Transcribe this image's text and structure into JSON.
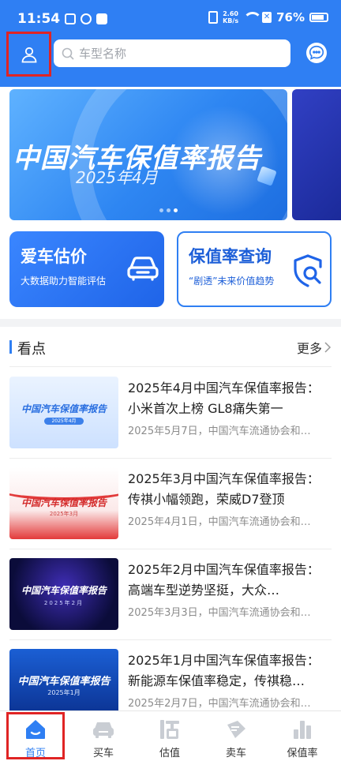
{
  "status_bar": {
    "time": "11:54",
    "net_speed_value": "2.60",
    "net_speed_unit": "KB/s",
    "battery": "76%",
    "icons": [
      "notification-icon",
      "app-icon",
      "tiktok-icon",
      "vibrate-icon",
      "wifi-icon",
      "sim-icon",
      "battery-icon"
    ]
  },
  "header": {
    "search_placeholder": "车型名称",
    "accent": "#2f7ff3",
    "icons": [
      "user-icon",
      "search-icon",
      "message-icon"
    ]
  },
  "banner": {
    "title": "中国汽车保值率报告",
    "date": "2025年4月",
    "pages": 3,
    "active_page": 2
  },
  "cards": {
    "valuation": {
      "title": "爱车估价",
      "subtitle": "大数据助力智能评估",
      "icon": "car-front-icon"
    },
    "query": {
      "title": "保值率查询",
      "subtitle": "“剧透”未来价值趋势",
      "icon": "shield-search-icon"
    }
  },
  "news": {
    "heading": "看点",
    "more_label": "更多",
    "articles": [
      {
        "title": "2025年4月中国汽车保值率报告：小米首次上榜 GL8痛失第一",
        "meta": "2025年5月7日，中国汽车流通协会和…",
        "thumb_title": "中国汽车保值率报告",
        "thumb_sub": "2025年4月"
      },
      {
        "title": "2025年3月中国汽车保值率报告：传祺小幅领跑，荣威D7登顶",
        "meta": "2025年4月1日，中国汽车流通协会和…",
        "thumb_title": "中国汽车保值率报告",
        "thumb_sub": "2025年3月"
      },
      {
        "title": "2025年2月中国汽车保值率报告：高端车型逆势坚挺，大众…",
        "meta": "2025年3月3日，中国汽车流通协会和…",
        "thumb_title": "中国汽车保值率报告",
        "thumb_sub": "2025年2月"
      },
      {
        "title": "2025年1月中国汽车保值率报告：新能源车保值率稳定，传祺稳…",
        "meta": "2025年2月7日，中国汽车流通协会和…",
        "thumb_title": "中国汽车保值率报告",
        "thumb_sub": "2025年1月"
      }
    ]
  },
  "bottom_nav": {
    "items": [
      {
        "label": "首页",
        "icon": "home-icon",
        "active": true
      },
      {
        "label": "买车",
        "icon": "car-icon",
        "active": false
      },
      {
        "label": "估值",
        "icon": "valuation-icon",
        "active": false
      },
      {
        "label": "卖车",
        "icon": "sale-tag-icon",
        "active": false
      },
      {
        "label": "保值率",
        "icon": "bar-chart-icon",
        "active": false
      }
    ],
    "active_color": "#2f7ff3",
    "inactive_color": "#c9cdd3"
  }
}
